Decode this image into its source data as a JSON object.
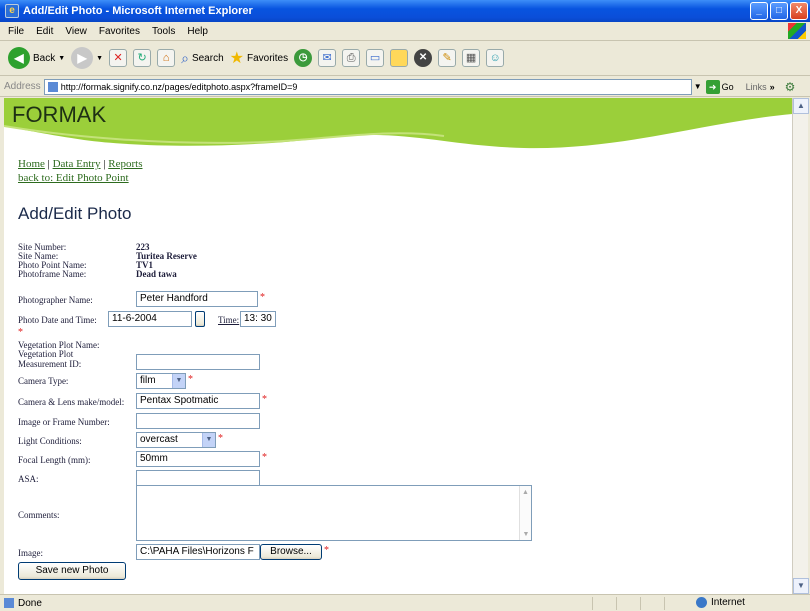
{
  "window": {
    "title": "Add/Edit Photo - Microsoft Internet Explorer",
    "minimize": "_",
    "maximize": "□",
    "close": "X"
  },
  "menu": [
    "File",
    "Edit",
    "View",
    "Favorites",
    "Tools",
    "Help"
  ],
  "toolbar": {
    "back": "Back",
    "search": "Search",
    "favorites": "Favorites"
  },
  "address": {
    "label": "Address",
    "url": "http://formak.signify.co.nz/pages/editphoto.aspx?frameID=9",
    "go": "Go",
    "links": "Links"
  },
  "colors": {
    "banner": "#9bcf3a",
    "link": "#2d6b1e",
    "required": "#e02020"
  },
  "site": {
    "logo": "FORMAK"
  },
  "nav": {
    "home": "Home",
    "sep1": "|",
    "data_entry": "Data Entry",
    "sep2": "|",
    "reports": "Reports",
    "back": "back to: Edit Photo Point"
  },
  "page": {
    "title": "Add/Edit Photo"
  },
  "info": {
    "site_number_label": "Site Number:",
    "site_number": "223",
    "site_name_label": "Site Name:",
    "site_name": "Turitea Reserve",
    "photo_point_label": "Photo Point Name:",
    "photo_point": "TV1",
    "photoframe_label": "Photoframe Name:",
    "photoframe": "Dead tawa"
  },
  "form": {
    "photographer_label": "Photographer Name:",
    "photographer": "Peter Handford",
    "date_label": "Photo Date and Time:",
    "date": "11-6-2004",
    "time_label": "Time:",
    "time": "13: 30",
    "veg_plot_label": "Vegetation Plot Name:",
    "veg_measure_label_1": "Vegetation Plot",
    "veg_measure_label_2": "Measurement ID:",
    "veg_measure": "",
    "camera_type_label": "Camera Type:",
    "camera_type": "film",
    "lens_label": "Camera & Lens make/model:",
    "lens": "Pentax Spotmatic",
    "frame_label": "Image or Frame Number:",
    "frame": "",
    "light_label": "Light Conditions:",
    "light": "overcast",
    "focal_label": "Focal Length (mm):",
    "focal": "50mm",
    "asa_label": "ASA:",
    "asa": "",
    "comments_label": "Comments:",
    "comments": "",
    "image_label": "Image:",
    "image": "C:\\PAHA Files\\Horizons F",
    "browse": "Browse...",
    "save": "Save new Photo",
    "required_mark": "*"
  },
  "status": {
    "text": "Done",
    "zone": "Internet"
  }
}
